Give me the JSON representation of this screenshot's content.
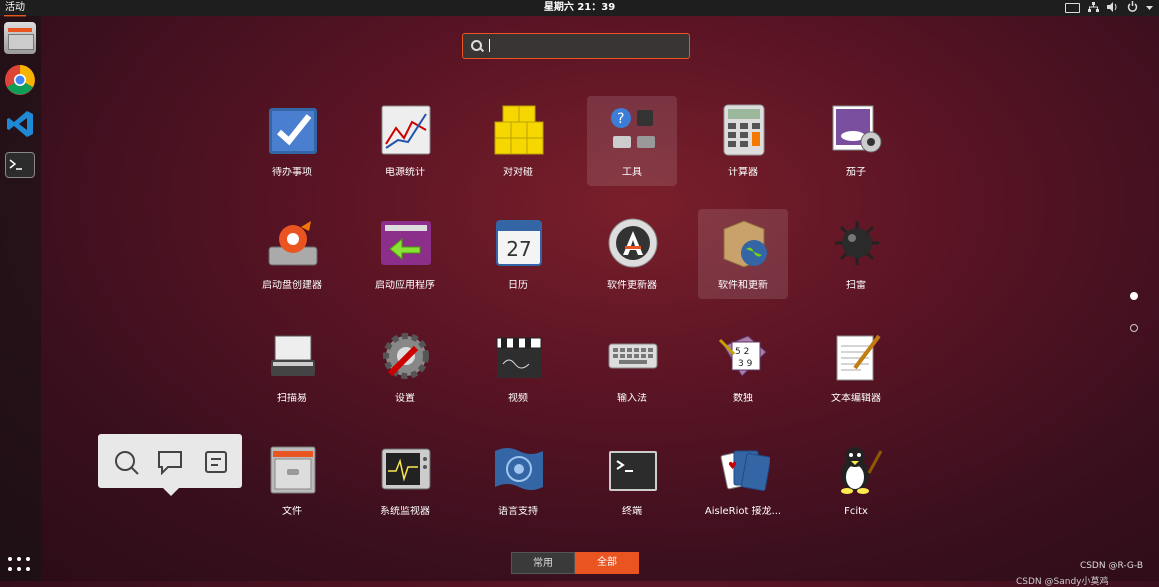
{
  "topbar": {
    "activities": "活动",
    "clock": "星期六 21：39"
  },
  "dock": {
    "items": [
      "files-icon",
      "chrome-icon",
      "vscode-icon",
      "terminal-icon"
    ]
  },
  "search": {
    "value": "",
    "placeholder": ""
  },
  "apps": [
    {
      "label": "待办事项",
      "icon": "todo-icon"
    },
    {
      "label": "电源统计",
      "icon": "power-stats-icon"
    },
    {
      "label": "对对碰",
      "icon": "swell-foop-icon"
    },
    {
      "label": "工具",
      "icon": "tools-folder-icon"
    },
    {
      "label": "计算器",
      "icon": "calculator-icon"
    },
    {
      "label": "茄子",
      "icon": "cheese-icon"
    },
    {
      "label": "启动盘创建器",
      "icon": "startup-disk-icon"
    },
    {
      "label": "启动应用程序",
      "icon": "startup-apps-icon"
    },
    {
      "label": "日历",
      "icon": "calendar-icon",
      "day": "27"
    },
    {
      "label": "软件更新器",
      "icon": "software-updater-icon"
    },
    {
      "label": "软件和更新",
      "icon": "software-updates-icon"
    },
    {
      "label": "扫雷",
      "icon": "mines-icon"
    },
    {
      "label": "扫描易",
      "icon": "scanner-icon"
    },
    {
      "label": "设置",
      "icon": "settings-icon"
    },
    {
      "label": "视频",
      "icon": "video-icon"
    },
    {
      "label": "输入法",
      "icon": "keyboard-icon"
    },
    {
      "label": "数独",
      "icon": "sudoku-icon"
    },
    {
      "label": "文本编辑器",
      "icon": "text-editor-icon"
    },
    {
      "label": "文件",
      "icon": "files-cabinet-icon"
    },
    {
      "label": "系统监视器",
      "icon": "system-monitor-icon"
    },
    {
      "label": "语言支持",
      "icon": "language-support-icon"
    },
    {
      "label": "终端",
      "icon": "terminal-app-icon"
    },
    {
      "label": "AisleRiot 接龙...",
      "icon": "aisleriot-icon"
    },
    {
      "label": "Fcitx",
      "icon": "fcitx-icon"
    }
  ],
  "tabs": {
    "frequent": "常用",
    "all": "全部"
  },
  "watermark": "CSDN @R-G-B",
  "watermark2": "CSDN @Sandy小莫鸡",
  "colors": {
    "accent": "#e95420",
    "topbar": "#1e1e1e"
  }
}
